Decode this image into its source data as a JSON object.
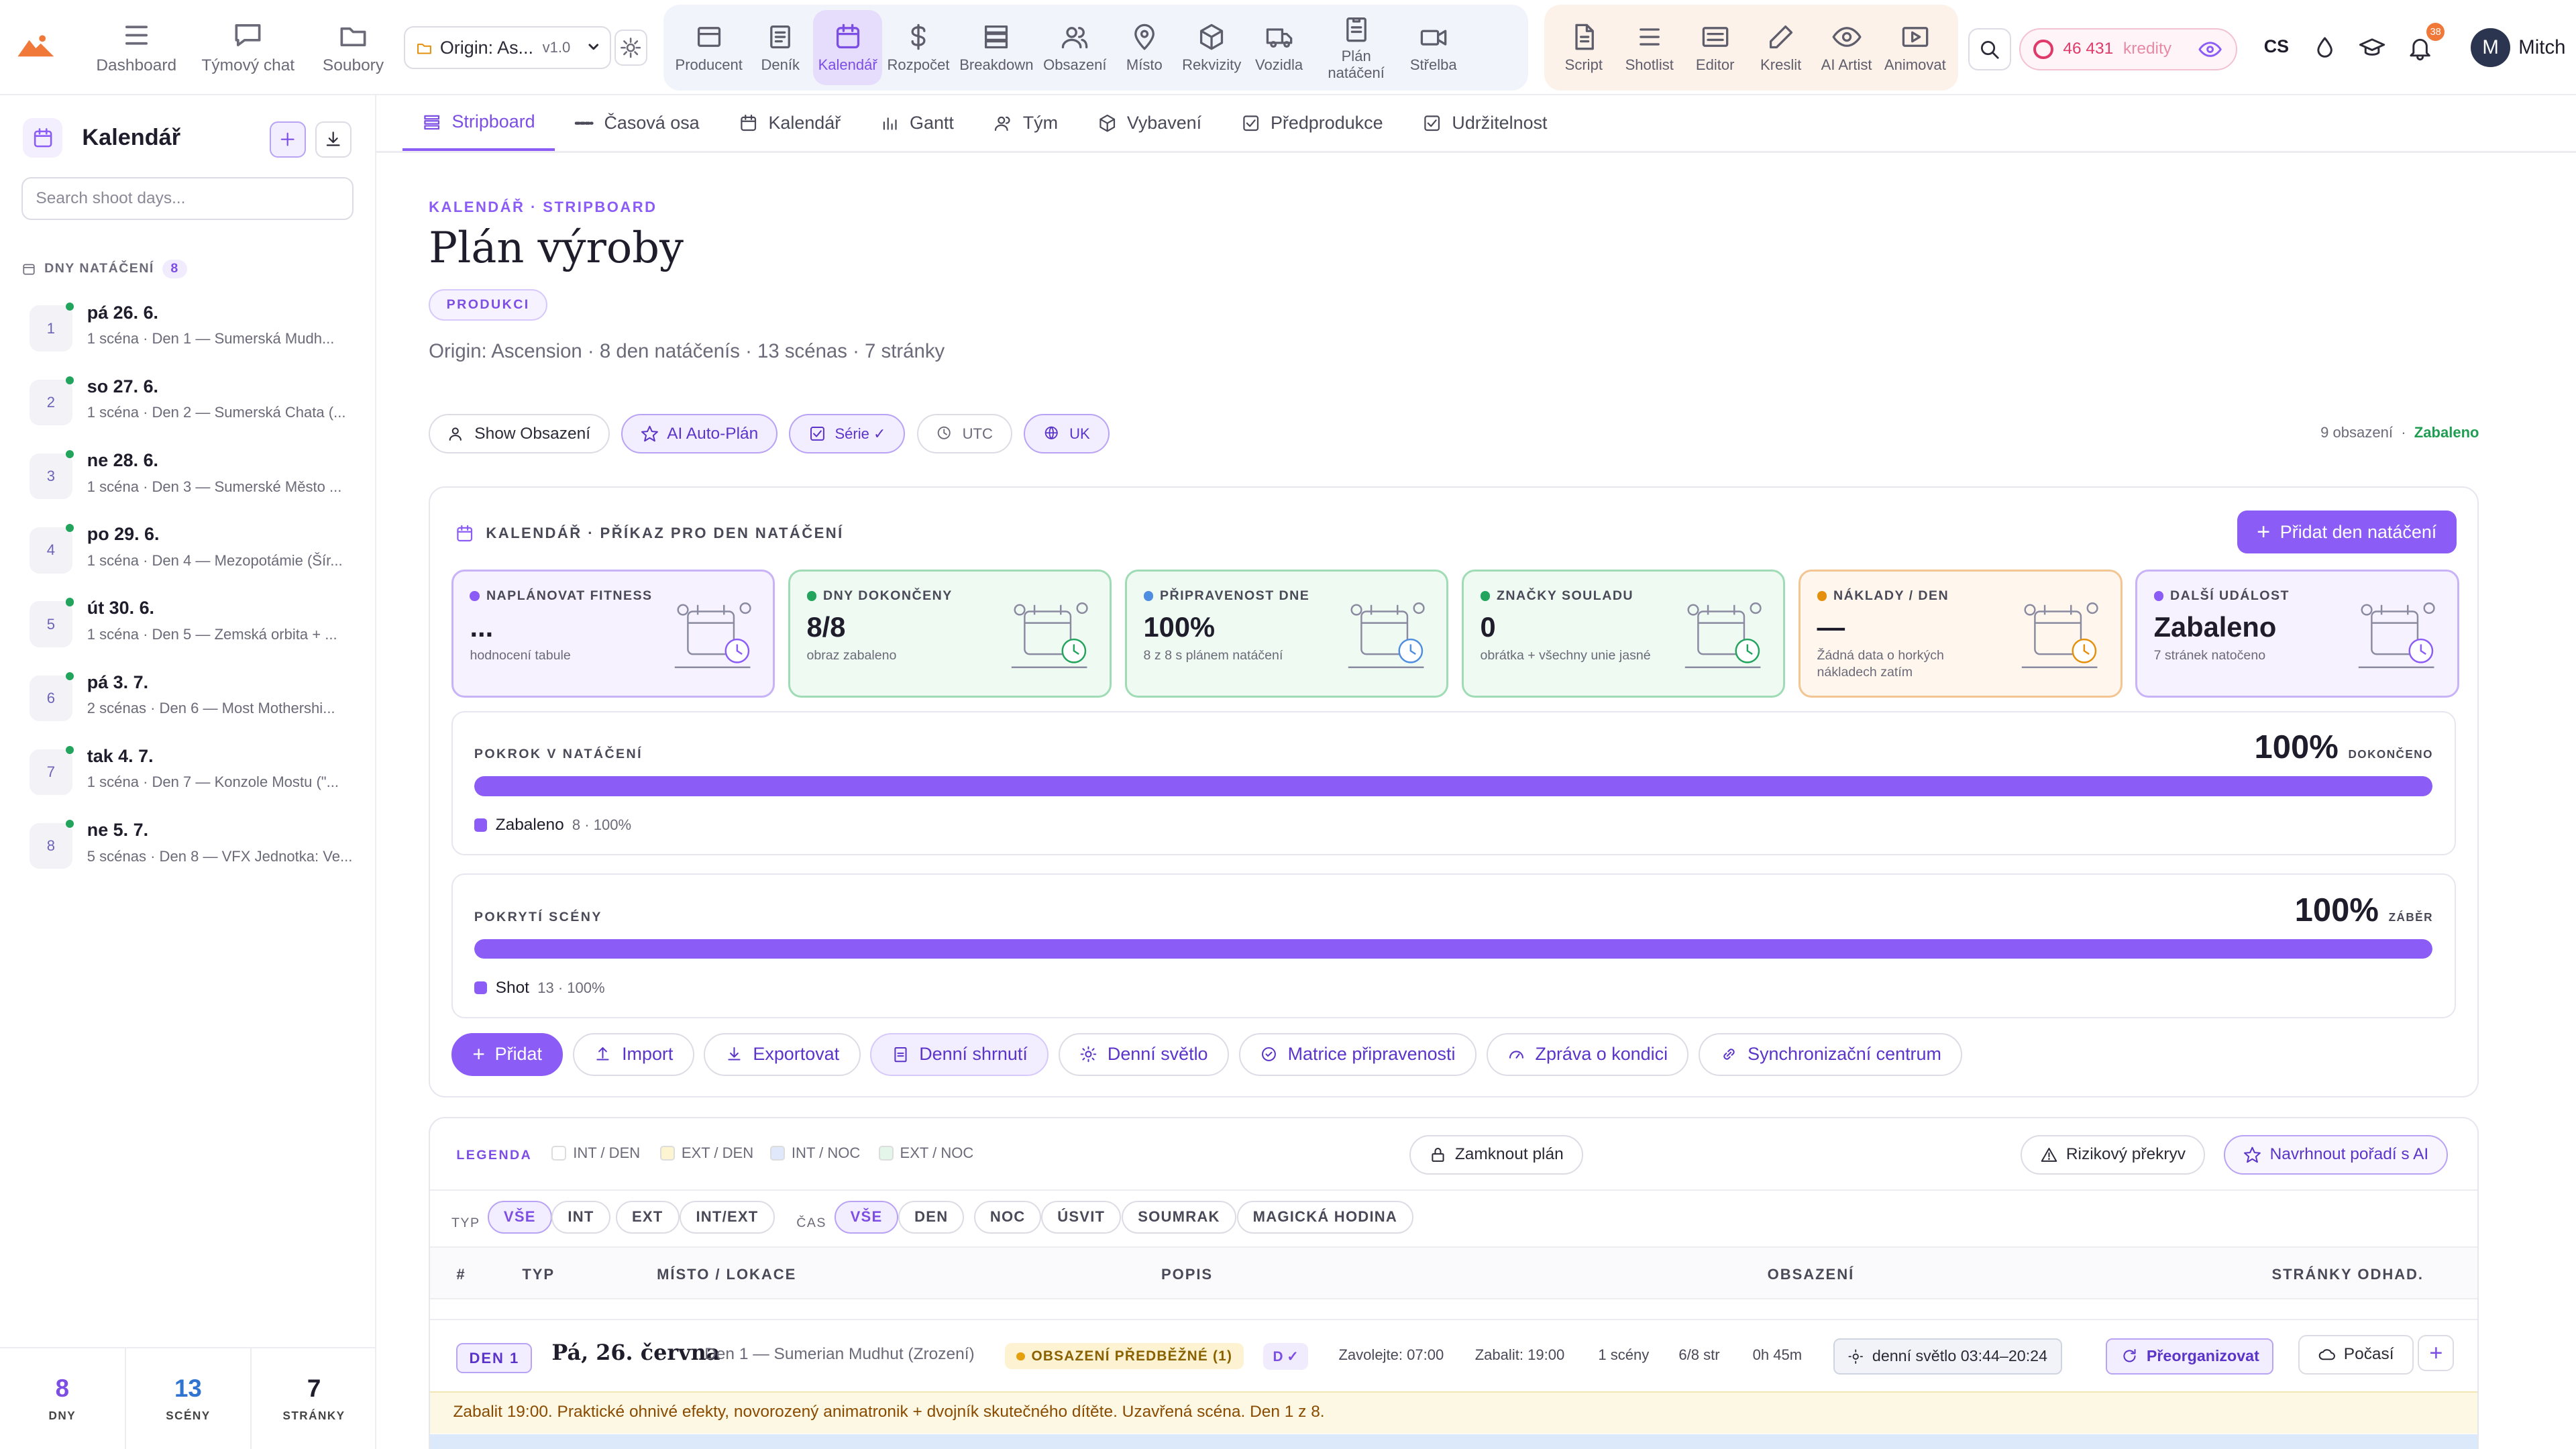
{
  "topbar": {
    "nav": [
      {
        "label": "Dashboard",
        "icon": "grid-icon"
      },
      {
        "label": "Týmový chat",
        "icon": "chat-icon"
      },
      {
        "label": "Soubory",
        "icon": "folder-icon"
      }
    ],
    "project": {
      "name": "Origin: As...",
      "version": "v1.0"
    },
    "tools_a": [
      {
        "label": "Producent",
        "icon": "producer-icon"
      },
      {
        "label": "Deník",
        "icon": "journal-icon"
      },
      {
        "label": "Kalendář",
        "icon": "calendar-icon",
        "active": true
      },
      {
        "label": "Rozpočet",
        "icon": "dollar-icon"
      },
      {
        "label": "Breakdown",
        "icon": "breakdown-icon"
      },
      {
        "label": "Obsazení",
        "icon": "users-icon"
      },
      {
        "label": "Místo",
        "icon": "map-pin-icon"
      },
      {
        "label": "Rekvizity",
        "icon": "cube-icon"
      },
      {
        "label": "Vozidla",
        "icon": "truck-icon"
      },
      {
        "label": "Plán natáčení",
        "icon": "clipboard-icon"
      },
      {
        "label": "Střelba",
        "icon": "camera-icon"
      }
    ],
    "tools_b": [
      {
        "label": "Script",
        "icon": "script-icon"
      },
      {
        "label": "Shotlist",
        "icon": "list-icon"
      },
      {
        "label": "Editor",
        "icon": "editor-icon"
      },
      {
        "label": "Kreslit",
        "icon": "pencil-icon"
      },
      {
        "label": "AI Artist",
        "icon": "eye-icon"
      },
      {
        "label": "Animovat",
        "icon": "play-icon"
      }
    ],
    "credits_value": "46 431",
    "credits_label": "kredity",
    "lang": "CS",
    "notif_count": "38",
    "user_initial": "M",
    "user_name": "Mitch"
  },
  "sidebar": {
    "title": "Kalendář",
    "search_placeholder": "Search shoot days...",
    "section_label": "DNY NATÁČENÍ",
    "section_count": "8",
    "days": [
      {
        "num": "1",
        "date": "pá 26. 6.",
        "sub": "1 scéna · Den 1 — Sumerská Mudh..."
      },
      {
        "num": "2",
        "date": "so 27. 6.",
        "sub": "1 scéna · Den 2 — Sumerská Chata (..."
      },
      {
        "num": "3",
        "date": "ne 28. 6.",
        "sub": "1 scéna · Den 3 — Sumerské Město ..."
      },
      {
        "num": "4",
        "date": "po 29. 6.",
        "sub": "1 scéna · Den 4 — Mezopotámie (Šír..."
      },
      {
        "num": "5",
        "date": "út 30. 6.",
        "sub": "1 scéna · Den 5 — Zemská orbita + ..."
      },
      {
        "num": "6",
        "date": "pá 3. 7.",
        "sub": "2 scénas · Den 6 — Most Mothershi..."
      },
      {
        "num": "7",
        "date": "tak 4. 7.",
        "sub": "1 scéna · Den 7 — Konzole Mostu (\"..."
      },
      {
        "num": "8",
        "date": "ne 5. 7.",
        "sub": "5 scénas · Den 8 — VFX Jednotka: Ve..."
      }
    ],
    "stats": [
      {
        "value": "8",
        "label": "DNY"
      },
      {
        "value": "13",
        "label": "SCÉNY"
      },
      {
        "value": "7",
        "label": "STRÁNKY"
      }
    ]
  },
  "tabs": [
    {
      "label": "Stripboard",
      "icon": "stripboard-icon",
      "active": true
    },
    {
      "label": "Časová osa",
      "icon": "timeline-icon"
    },
    {
      "label": "Kalendář",
      "icon": "calendar-icon"
    },
    {
      "label": "Gantt",
      "icon": "gantt-icon"
    },
    {
      "label": "Tým",
      "icon": "users-icon"
    },
    {
      "label": "Vybavení",
      "icon": "cube-icon"
    },
    {
      "label": "Předprodukce",
      "icon": "checkbox-icon"
    },
    {
      "label": "Udržitelnost",
      "icon": "checkbox-icon"
    }
  ],
  "header": {
    "eyebrow": "KALENDÁŘ · STRIPBOARD",
    "title": "Plán výroby",
    "badge": "PRODUKCI",
    "subtitle": "Origin: Ascension · 8 den natáčenís · 13 scénas · 7 stránky",
    "chips": {
      "show_cast": "Show Obsazení",
      "ai_plan": "AI Auto-Plán",
      "series": "Série ✓",
      "utc": "UTC",
      "uk": "UK"
    },
    "meta_count": "9 obsazení",
    "meta_sep": "·",
    "meta_status": "Zabaleno"
  },
  "panel": {
    "title": "KALENDÁŘ · PŘÍKAZ PRO DEN NATÁČENÍ",
    "add_day": "Přidat den natáčení",
    "cards": [
      {
        "label": "NAPLÁNOVAT FITNESS",
        "value": "...",
        "sub": "hodnocení tabule",
        "color": "#8b5cf6",
        "bg": "#f6f2ff",
        "border": "#c9b3f7"
      },
      {
        "label": "DNY DOKONČENY",
        "value": "8/8",
        "sub": "obraz zabaleno",
        "color": "#22a45d",
        "bg": "#effaf3",
        "border": "#9fdcb6"
      },
      {
        "label": "PŘIPRAVENOST DNE",
        "value": "100%",
        "sub": "8 z 8 s plánem natáčení",
        "color": "#4f8de0",
        "bg": "#effaf3",
        "border": "#9fdcb6"
      },
      {
        "label": "ZNAČKY SOULADU",
        "value": "0",
        "sub": "obrátka + všechny unie jasné",
        "color": "#22a45d",
        "bg": "#effaf3",
        "border": "#9fdcb6"
      },
      {
        "label": "NÁKLADY / DEN",
        "value": "—",
        "sub": "Žádná data o horkých nákladech zatím",
        "color": "#e5900d",
        "bg": "#fff7ee",
        "border": "#f2c592"
      },
      {
        "label": "DALŠÍ UDÁLOST",
        "value": "Zabaleno",
        "sub": "7 stránek natočeno",
        "color": "#8b5cf6",
        "bg": "#f6f2ff",
        "border": "#c9b3f7"
      }
    ],
    "progress": [
      {
        "label": "POKROK V NATÁČENÍ",
        "value": "100%",
        "unit": "DOKONČENO",
        "fraction": 1.0,
        "legend": "Zabaleno",
        "legend_meta": "8 · 100%"
      },
      {
        "label": "POKRYTÍ SCÉNY",
        "value": "100%",
        "unit": "ZÁBĚR",
        "fraction": 1.0,
        "legend": "Shot",
        "legend_meta": "13 · 100%"
      }
    ],
    "actions": [
      {
        "label": "Přidat",
        "icon": "plus-icon"
      },
      {
        "label": "Import",
        "icon": "upload-icon"
      },
      {
        "label": "Exportovat",
        "icon": "download-icon"
      },
      {
        "label": "Denní shrnutí",
        "icon": "clipboard-icon"
      },
      {
        "label": "Denní světlo",
        "icon": "sun-icon"
      },
      {
        "label": "Matrice připravenosti",
        "icon": "check-circle-icon"
      },
      {
        "label": "Zpráva o kondici",
        "icon": "gauge-icon"
      },
      {
        "label": "Synchronizační centrum",
        "icon": "link-icon"
      }
    ]
  },
  "stripboard": {
    "legend_title": "LEGENDA",
    "legend": [
      {
        "label": "INT / DEN",
        "color": "#ffffff"
      },
      {
        "label": "EXT / DEN",
        "color": "#fdf5d2"
      },
      {
        "label": "INT / NOC",
        "color": "#dfe9fb"
      },
      {
        "label": "EXT / NOC",
        "color": "#e4f6ea"
      }
    ],
    "lock_plan": "Zamknout plán",
    "risk": "Rizikový překryv",
    "ai_order": "Navrhnout pořadí s AI",
    "type_label": "TYP",
    "type_filters": [
      "VŠE",
      "INT",
      "EXT",
      "INT/EXT"
    ],
    "time_label": "ČAS",
    "time_filters": [
      "VŠE",
      "DEN",
      "NOC",
      "ÚSVIT",
      "SOUMRAK",
      "MAGICKÁ HODINA"
    ],
    "columns": [
      "#",
      "TYP",
      "MÍSTO / LOKACE",
      "POPIS",
      "OBSAZENÍ",
      "STRÁNKY ODHAD."
    ],
    "day1": {
      "tag": "DEN 1",
      "title": "Pá, 26. června",
      "sub": "Den 1 — Sumerian Mudhut (Zrození)",
      "warning": "OBSAZENÍ PŘEDBĚŽNÉ (1)",
      "d_tag": "D ✓",
      "call": "Zavolejte: 07:00",
      "wrap": "Zabalit: 19:00",
      "scenes": "1 scény",
      "pages": "6/8 str",
      "duration": "0h 45m",
      "daylight": "denní světlo 03:44–20:24",
      "reorg": "Přeorganizovat",
      "weather": "Počasí",
      "note": "Zabalit 19:00. Praktické ohnivé efekty, novorozený animatronik + dvojník skutečného dítěte. Uzavřená scéna. Den 1 z 8."
    }
  }
}
